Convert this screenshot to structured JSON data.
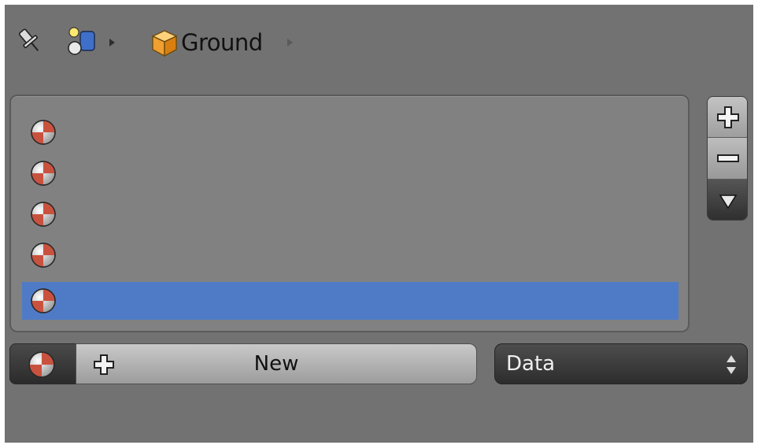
{
  "header": {
    "object_name": "Ground",
    "icons": [
      "pin-icon",
      "scene-context-icon",
      "arrow-right-icon",
      "object-cube-icon",
      "arrow-right-icon"
    ]
  },
  "material_slots": {
    "items": [
      {
        "icon": "material-icon",
        "label": "",
        "selected": false
      },
      {
        "icon": "material-icon",
        "label": "",
        "selected": false
      },
      {
        "icon": "material-icon",
        "label": "",
        "selected": false
      },
      {
        "icon": "material-icon",
        "label": "",
        "selected": false
      },
      {
        "icon": "material-icon",
        "label": "",
        "selected": true
      }
    ],
    "side_controls": [
      "plus-icon",
      "minus-icon",
      "dropdown-triangle-icon"
    ]
  },
  "bottom_bar": {
    "new_label": "New",
    "link_value": "Data"
  },
  "colors": {
    "panel_bg": "#727272",
    "list_bg": "#818181",
    "selection": "#4f7bc6"
  }
}
